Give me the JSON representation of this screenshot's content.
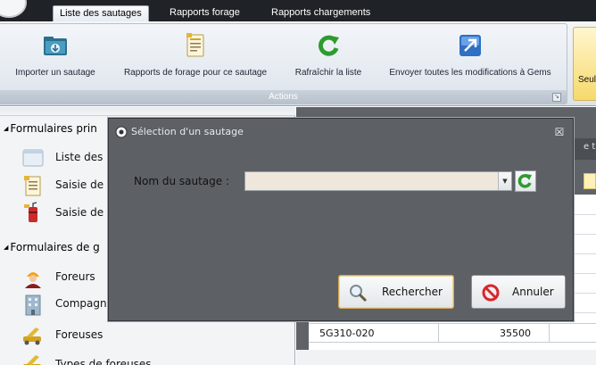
{
  "tabs": [
    {
      "label": "Liste des sautages",
      "active": true
    },
    {
      "label": "Rapports forage",
      "active": false
    },
    {
      "label": "Rapports chargements",
      "active": false
    }
  ],
  "ribbon": {
    "group_label": "Actions",
    "launcher_glyph": "↘",
    "buttons": [
      {
        "label": "Importer un sautage",
        "icon": "folder-import-icon"
      },
      {
        "label": "Rapports de forage pour ce sautage",
        "icon": "report-document-icon"
      },
      {
        "label": "Rafraîchir la liste",
        "icon": "refresh-icon"
      },
      {
        "label": "Envoyer toutes les modifications à Gems",
        "icon": "send-arrow-icon"
      }
    ],
    "partial_button_label": "Seul"
  },
  "sidebar": {
    "sections": [
      {
        "label": "Formulaires prin",
        "items": [
          "Liste des",
          "Saisie de",
          "Saisie de"
        ]
      },
      {
        "label": "Formulaires de g",
        "items": [
          "Foreurs",
          "Compagn",
          "Foreuses",
          "Types de foreuses"
        ]
      }
    ]
  },
  "grid": {
    "header_partial": "e t",
    "row": {
      "name": "5G310-020",
      "value": "35500"
    }
  },
  "dialog": {
    "title": "Sélection d'un sautage",
    "close_glyph": "☒",
    "field_label": "Nom du sautage :",
    "field_value": "",
    "dropdown_glyph": "▼",
    "search_button": "Rechercher",
    "cancel_button": "Annuler"
  },
  "colors": {
    "accent_green": "#2e9b2e",
    "dialog_background": "#5d6166",
    "focus_border": "#d6a851",
    "cancel_red": "#d9272b"
  }
}
